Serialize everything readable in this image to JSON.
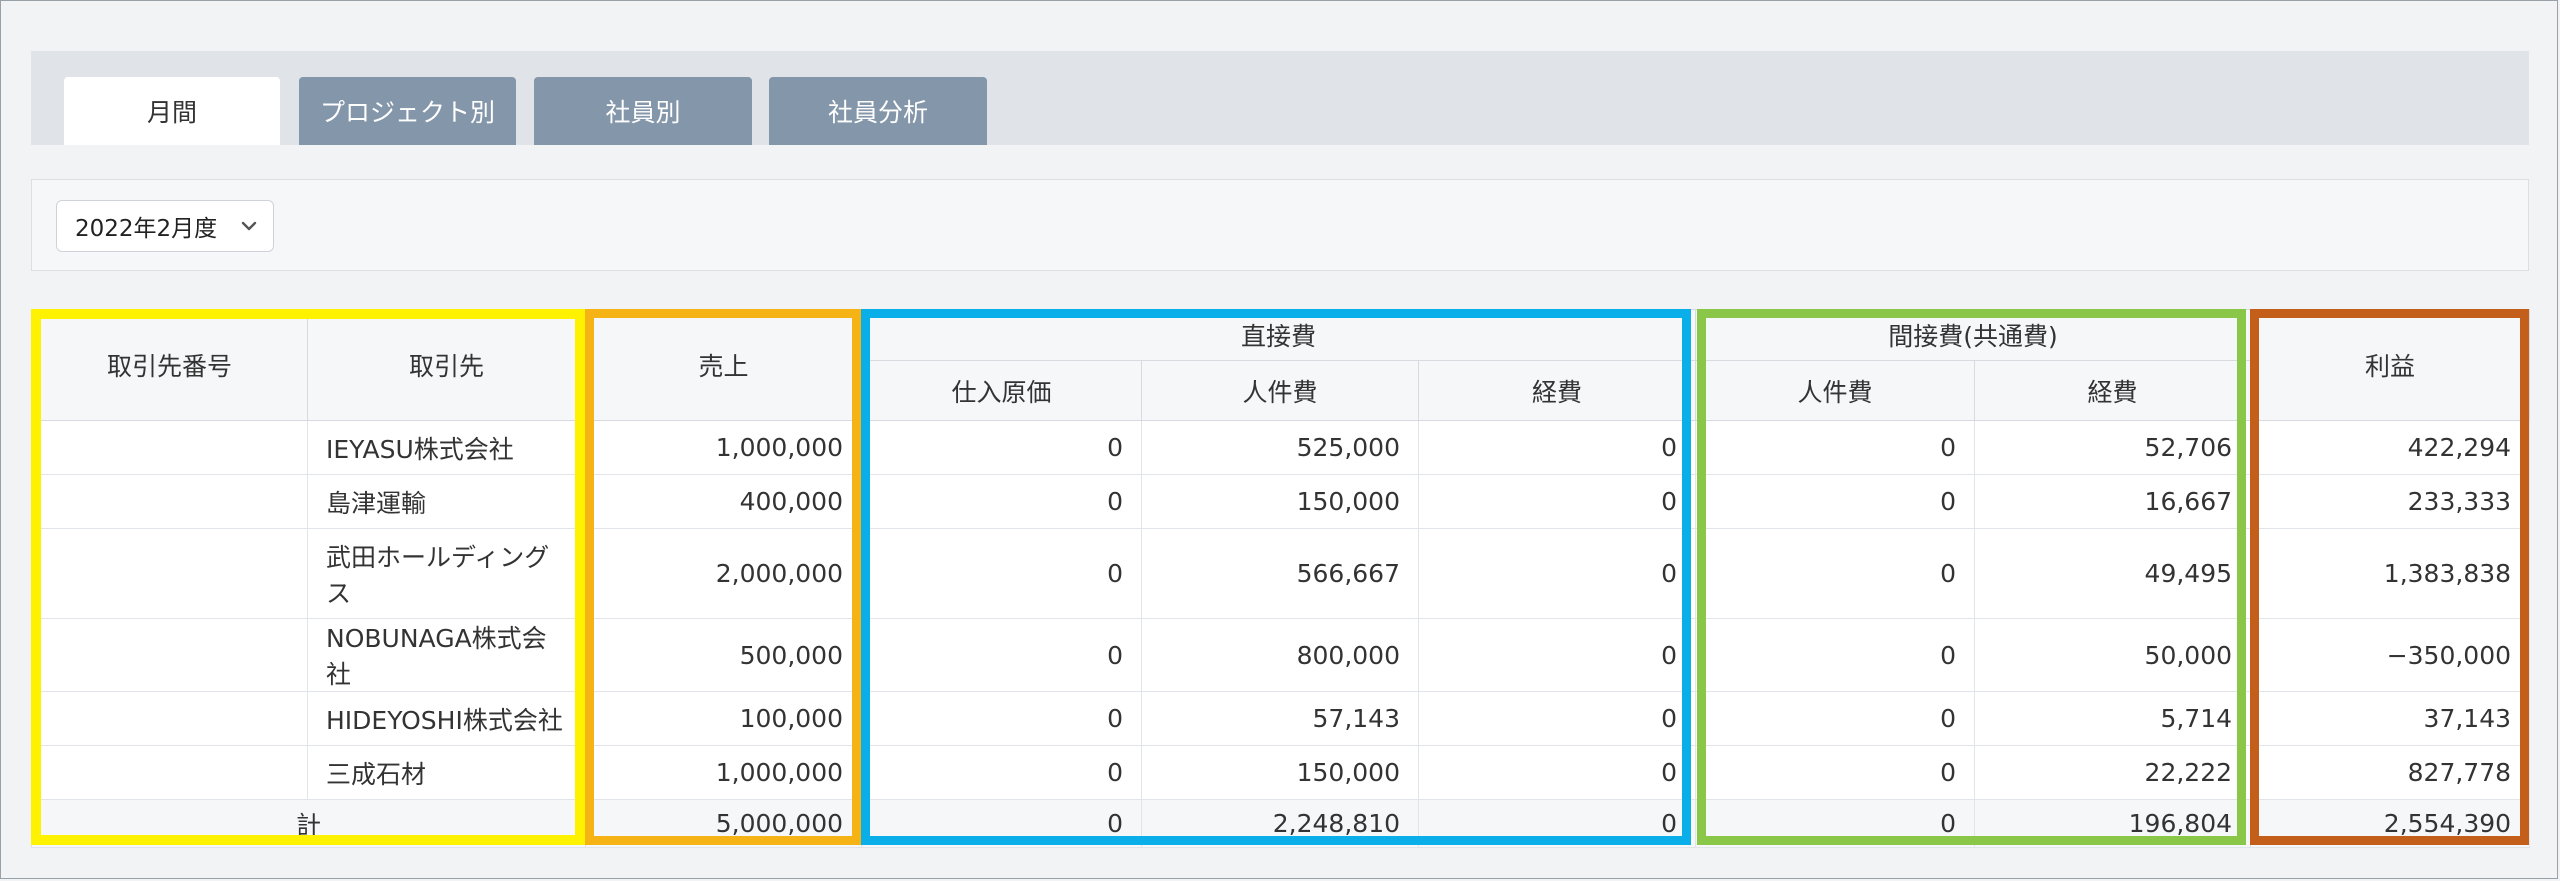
{
  "tabs": [
    {
      "label": "月間",
      "active": true
    },
    {
      "label": "プロジェクト別",
      "active": false
    },
    {
      "label": "社員別",
      "active": false
    },
    {
      "label": "社員分析",
      "active": false
    }
  ],
  "period_select": {
    "value": "2022年2月度"
  },
  "table": {
    "headers": {
      "client_no": "取引先番号",
      "client": "取引先",
      "sales": "売上",
      "direct_group": "直接費",
      "direct_purchase": "仕入原価",
      "direct_labor": "人件費",
      "direct_expense": "経費",
      "indirect_group": "間接費(共通費)",
      "indirect_labor": "人件費",
      "indirect_expense": "経費",
      "profit": "利益"
    },
    "rows": [
      {
        "no": "",
        "client": "IEYASU株式会社",
        "sales": "1,000,000",
        "d_purchase": "0",
        "d_labor": "525,000",
        "d_expense": "0",
        "i_labor": "0",
        "i_expense": "52,706",
        "profit": "422,294"
      },
      {
        "no": "",
        "client": "島津運輸",
        "sales": "400,000",
        "d_purchase": "0",
        "d_labor": "150,000",
        "d_expense": "0",
        "i_labor": "0",
        "i_expense": "16,667",
        "profit": "233,333"
      },
      {
        "no": "",
        "client": "武田ホールディングス",
        "sales": "2,000,000",
        "d_purchase": "0",
        "d_labor": "566,667",
        "d_expense": "0",
        "i_labor": "0",
        "i_expense": "49,495",
        "profit": "1,383,838"
      },
      {
        "no": "",
        "client": "NOBUNAGA株式会社",
        "sales": "500,000",
        "d_purchase": "0",
        "d_labor": "800,000",
        "d_expense": "0",
        "i_labor": "0",
        "i_expense": "50,000",
        "profit": "−350,000"
      },
      {
        "no": "",
        "client": "HIDEYOSHI株式会社",
        "sales": "100,000",
        "d_purchase": "0",
        "d_labor": "57,143",
        "d_expense": "0",
        "i_labor": "0",
        "i_expense": "5,714",
        "profit": "37,143"
      },
      {
        "no": "",
        "client": "三成石材",
        "sales": "1,000,000",
        "d_purchase": "0",
        "d_labor": "150,000",
        "d_expense": "0",
        "i_labor": "0",
        "i_expense": "22,222",
        "profit": "827,778"
      }
    ],
    "total": {
      "label": "計",
      "sales": "5,000,000",
      "d_purchase": "0",
      "d_labor": "2,248,810",
      "d_expense": "0",
      "i_labor": "0",
      "i_expense": "196,804",
      "profit": "2,554,390"
    }
  },
  "highlight_colors": {
    "yellow": "#fff200",
    "orange": "#f5b315",
    "blue": "#0aaee8",
    "green": "#8ac647",
    "rust": "#c45e1b"
  }
}
